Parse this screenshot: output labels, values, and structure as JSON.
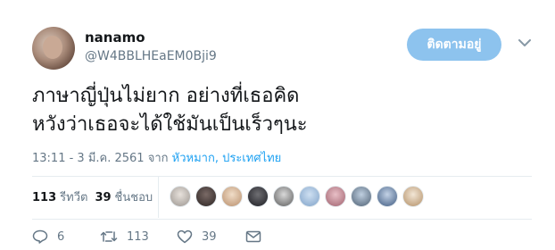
{
  "tweet": {
    "display_name": "nanamo",
    "handle": "@W4BBLHEaEM0Bji9",
    "follow_label": "ติดตามอยู่",
    "text_lines": [
      "ภาษาญี่ปุ่นไม่ยาก อย่างที่เธอคิด",
      "หวังว่าเธอจะได้ใช้มันเป็นเร็วๆนะ"
    ],
    "timestamp": "13:11 - 3 มี.ค. 2561 จาก",
    "location": "หัวหมาก, ประเทศไทย",
    "stats": {
      "retweets_count": "113",
      "retweets_label": "รีทวีต",
      "likes_count": "39",
      "likes_label": "ชื่นชอบ"
    },
    "actions": {
      "reply_count": "6",
      "retweet_count": "113",
      "like_count": "39"
    }
  },
  "colors": {
    "accent": "#1da1f2",
    "follow_button": "#8dc3ee",
    "muted": "#657786"
  },
  "icons": [
    "chevron-down-icon",
    "reply-icon",
    "retweet-icon",
    "like-icon",
    "dm-icon"
  ]
}
